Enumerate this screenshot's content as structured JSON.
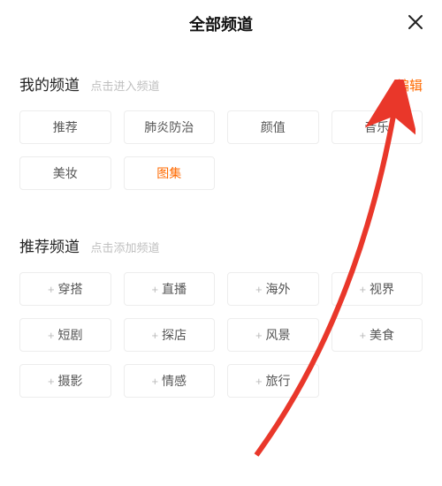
{
  "header": {
    "title": "全部频道"
  },
  "my_channels": {
    "title": "我的频道",
    "hint": "点击进入频道",
    "edit": "编辑",
    "items": [
      {
        "label": "推荐",
        "active": false
      },
      {
        "label": "肺炎防治",
        "active": false
      },
      {
        "label": "颜值",
        "active": false
      },
      {
        "label": "音乐",
        "active": false
      },
      {
        "label": "美妆",
        "active": false
      },
      {
        "label": "图集",
        "active": true
      }
    ]
  },
  "recommended_channels": {
    "title": "推荐频道",
    "hint": "点击添加频道",
    "items": [
      {
        "label": "穿搭"
      },
      {
        "label": "直播"
      },
      {
        "label": "海外"
      },
      {
        "label": "视界"
      },
      {
        "label": "短剧"
      },
      {
        "label": "探店"
      },
      {
        "label": "风景"
      },
      {
        "label": "美食"
      },
      {
        "label": "摄影"
      },
      {
        "label": "情感"
      },
      {
        "label": "旅行"
      }
    ]
  },
  "colors": {
    "accent": "#ff6a00",
    "arrow": "#e9372a"
  }
}
